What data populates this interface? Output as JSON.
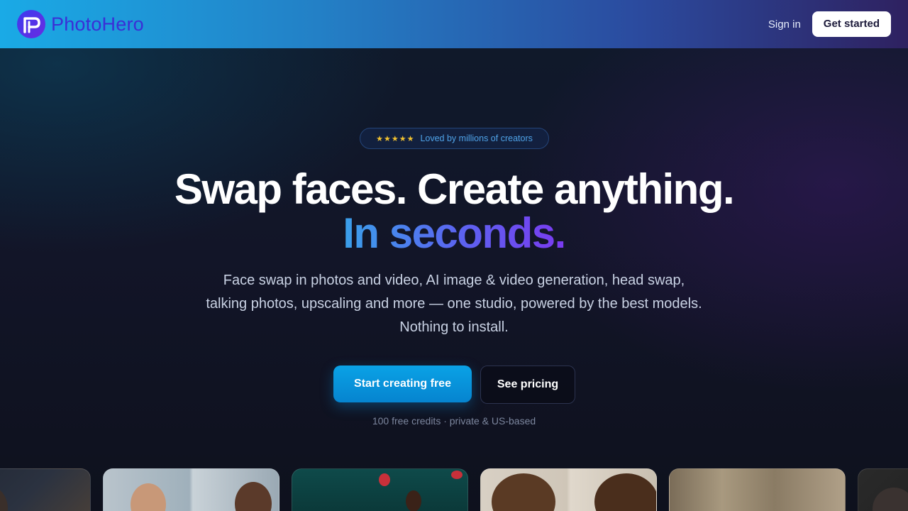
{
  "header": {
    "brand_name": "PhotoHero",
    "sign_in": "Sign in",
    "get_started": "Get started"
  },
  "hero": {
    "badge_stars": "★★★★★",
    "badge_text": "Loved by millions of creators",
    "headline_1": "Swap faces. Create anything.",
    "headline_2": "In seconds.",
    "subheadline": "Face swap in photos and video, AI image & video generation, head swap, talking photos, upscaling and more — one studio, powered by the best models. Nothing to install.",
    "cta_primary": "Start creating free",
    "cta_secondary": "See pricing",
    "footnote": "100 free credits · private & US-based"
  },
  "colors": {
    "accent": "#0a9be0",
    "brand": "#3a2fd6",
    "star": "#f2c230",
    "gradient_text": [
      "#3aa0ea",
      "#5a66f0",
      "#7a3af0"
    ]
  },
  "icons": {
    "logo": "photohero-logo-icon"
  }
}
